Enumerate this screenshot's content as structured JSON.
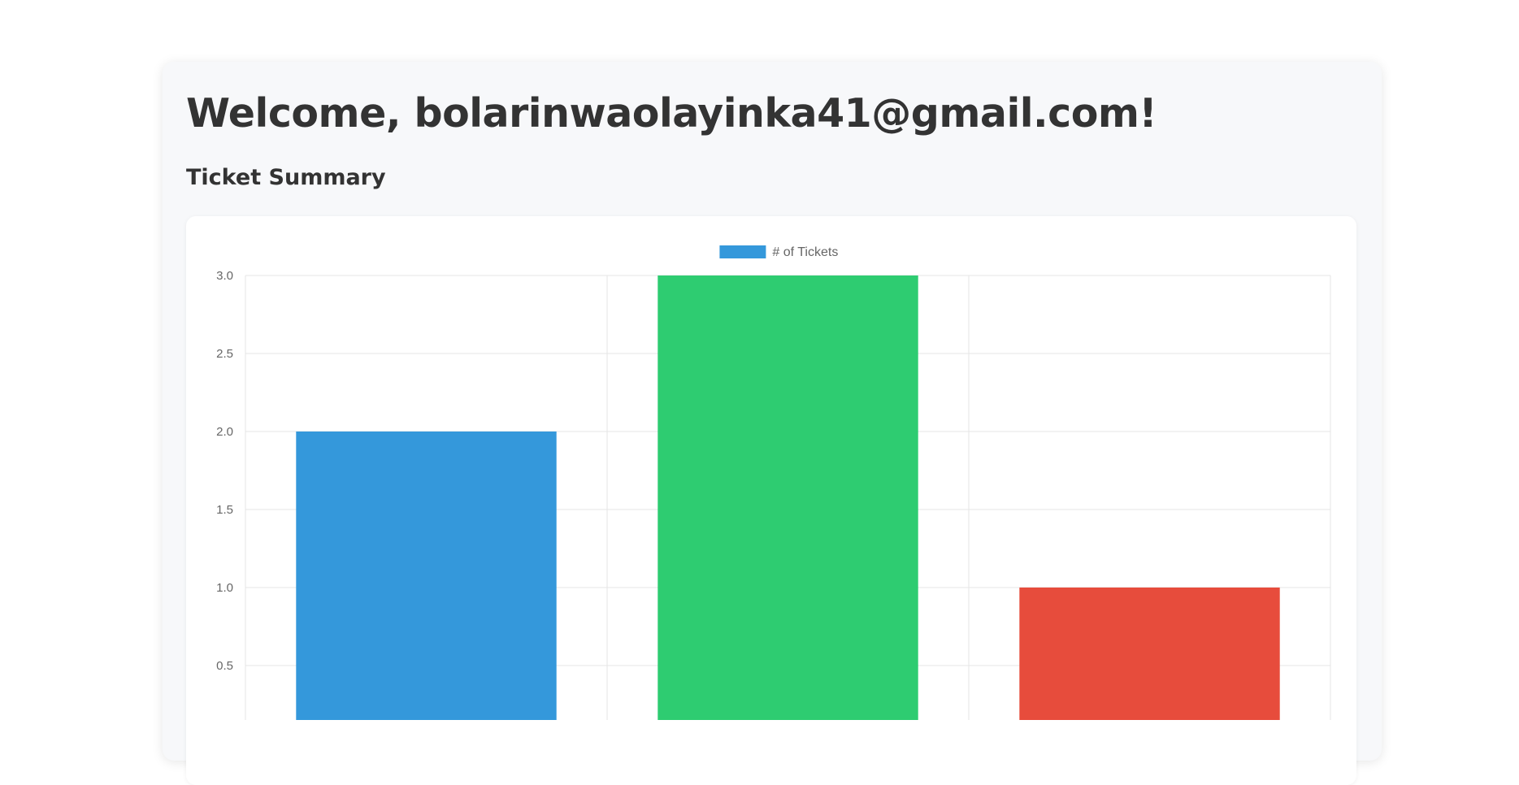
{
  "header": {
    "welcome": "Welcome, bolarinwaolayinka41@gmail.com!"
  },
  "summary": {
    "title": "Ticket Summary"
  },
  "chart_data": {
    "type": "bar",
    "series": [
      {
        "name": "# of Tickets",
        "values": [
          2,
          3,
          1
        ],
        "colors": [
          "#3498db",
          "#2ecc71",
          "#e74c3c"
        ]
      }
    ],
    "ylim": [
      0,
      3
    ],
    "yticks": [
      "3.0",
      "2.5",
      "2.0",
      "1.5",
      "1.0",
      "0.5"
    ],
    "grid": true,
    "legend": "top-center",
    "colors": {
      "grid": "#e5e5e5",
      "tick_text": "#666666"
    }
  }
}
